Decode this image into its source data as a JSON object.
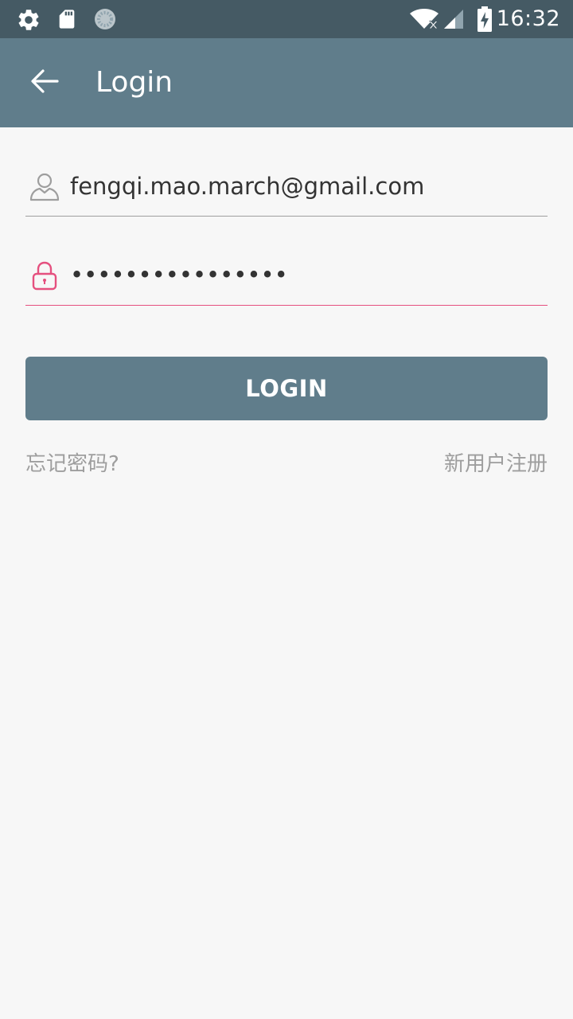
{
  "status_bar": {
    "time": "16:32",
    "icons": [
      "settings-icon",
      "sd-card-icon",
      "sync-icon",
      "wifi-icon",
      "signal-icon",
      "battery-charging-icon"
    ]
  },
  "app_bar": {
    "title": "Login",
    "back_icon": "arrow-back-icon"
  },
  "form": {
    "email": {
      "value": "fengqi.mao.march@gmail.com",
      "icon": "user-icon"
    },
    "password": {
      "value": "••••••••••••••••",
      "icon": "lock-icon"
    },
    "login_label": "LOGIN",
    "forgot_password_label": "忘记密码?",
    "register_label": "新用户注册"
  },
  "colors": {
    "status_bar": "#455a64",
    "primary": "#607d8b",
    "accent": "#e5507f",
    "background": "#f7f7f7",
    "link_text": "#9e9e9e"
  }
}
